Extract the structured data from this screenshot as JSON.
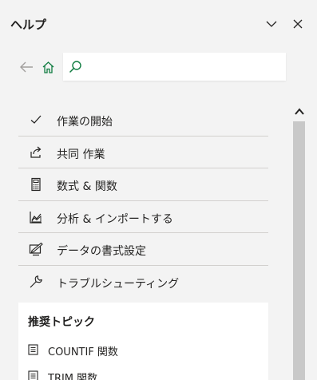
{
  "pane": {
    "title": "ヘルプ",
    "icons": {
      "collapse": "chevron-down-icon",
      "close": "close-icon"
    }
  },
  "nav": {
    "back_icon": "arrow-left-icon",
    "home_icon": "home-icon",
    "search": {
      "placeholder": "",
      "value": "",
      "icon": "search-icon"
    }
  },
  "menu": {
    "items": [
      {
        "label": "作業の開始",
        "icon": "checkmark-icon"
      },
      {
        "label": "共同 作業",
        "icon": "share-icon"
      },
      {
        "label": "数式 & 関数",
        "icon": "calculator-icon"
      },
      {
        "label": "分析 & インポートする",
        "icon": "chart-icon"
      },
      {
        "label": "データの書式設定",
        "icon": "format-edit-icon"
      },
      {
        "label": "トラブルシューティング",
        "icon": "wrench-icon"
      }
    ]
  },
  "topics": {
    "title": "推奨トピック",
    "items": [
      {
        "label": "COUNTIF 関数",
        "icon": "document-icon"
      },
      {
        "label": "TRIM 関数",
        "icon": "document-icon"
      }
    ]
  },
  "colors": {
    "background": "#f3f3f3",
    "accent_green": "#107c41",
    "divider": "#d2d0ce",
    "scrollbar": "#c8c8c8"
  }
}
